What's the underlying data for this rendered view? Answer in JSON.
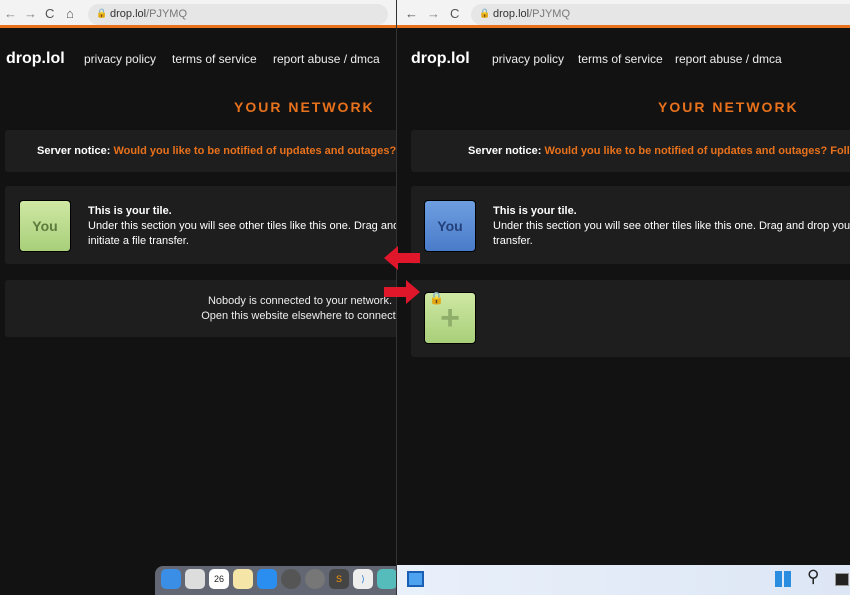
{
  "browser": {
    "back": "←",
    "forward": "→",
    "reload": "C",
    "home": "⌂",
    "url_host": "drop.lol",
    "url_path": "/PJYMQ"
  },
  "nav": {
    "logo": "drop.lol",
    "links": [
      "privacy policy",
      "terms of service",
      "report abuse / dmca"
    ]
  },
  "heading": "YOUR NETWORK",
  "notice": {
    "label": "Server notice:",
    "left_question": "Would you like to be notified of updates and outages?",
    "right_question": "Would you like to be notified of updates and outages? Follo"
  },
  "your_tile": {
    "label": "You",
    "title": "This is your tile.",
    "text": "Under this section you will see other tiles like this one. Drag and drop your files onto one to initiate a file transfer."
  },
  "empty": {
    "line1": "Nobody is connected to your network.",
    "line2": "Open this website elsewhere to connect."
  },
  "peer_tile": {
    "icon": "plus-icon",
    "locked": true
  },
  "colors": {
    "accent": "#e8711c",
    "you_left": "#b8dc8c",
    "you_right": "#5b8ad6",
    "arrow": "#e0162b"
  },
  "mac_dock": {
    "calendar_day": "26",
    "apps": [
      "finder",
      "launchpad",
      "calendar",
      "notes",
      "app-store",
      "system-preferences",
      "tableplus",
      "sublime-text",
      "vscode",
      "files"
    ]
  },
  "win_taskbar": {
    "icons": [
      "widgets",
      "start",
      "search",
      "task-view"
    ]
  }
}
